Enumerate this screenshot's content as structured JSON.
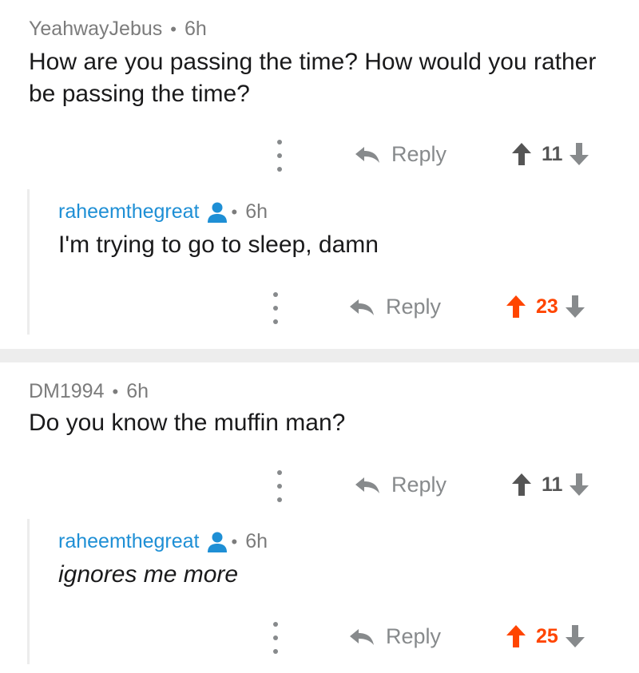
{
  "comments": [
    {
      "author": "YeahwayJebus",
      "time": "6h",
      "text": "How are you passing the time? How would you rather be passing the time?",
      "reply_label": "Reply",
      "score": "11",
      "upvoted": false,
      "child": {
        "author": "raheemthegreat",
        "time": "6h",
        "text": "I'm trying to go to sleep, damn",
        "reply_label": "Reply",
        "score": "23",
        "upvoted": true
      }
    },
    {
      "author": "DM1994",
      "time": "6h",
      "text": "Do you know the muffin man?",
      "reply_label": "Reply",
      "score": "11",
      "upvoted": false,
      "child": {
        "author": "raheemthegreat",
        "time": "6h",
        "text": "ignores me more",
        "reply_label": "Reply",
        "score": "25",
        "upvoted": true
      }
    }
  ],
  "colors": {
    "upvote_active": "#ff4500",
    "op_username": "#1e8fd5",
    "meta_gray": "#7c7c7c",
    "icon_gray": "#878a8c",
    "divider": "#ededed"
  },
  "icons": [
    "more-vertical-icon",
    "reply-arrow-icon",
    "upvote-arrow-icon",
    "downvote-arrow-icon",
    "user-icon"
  ]
}
